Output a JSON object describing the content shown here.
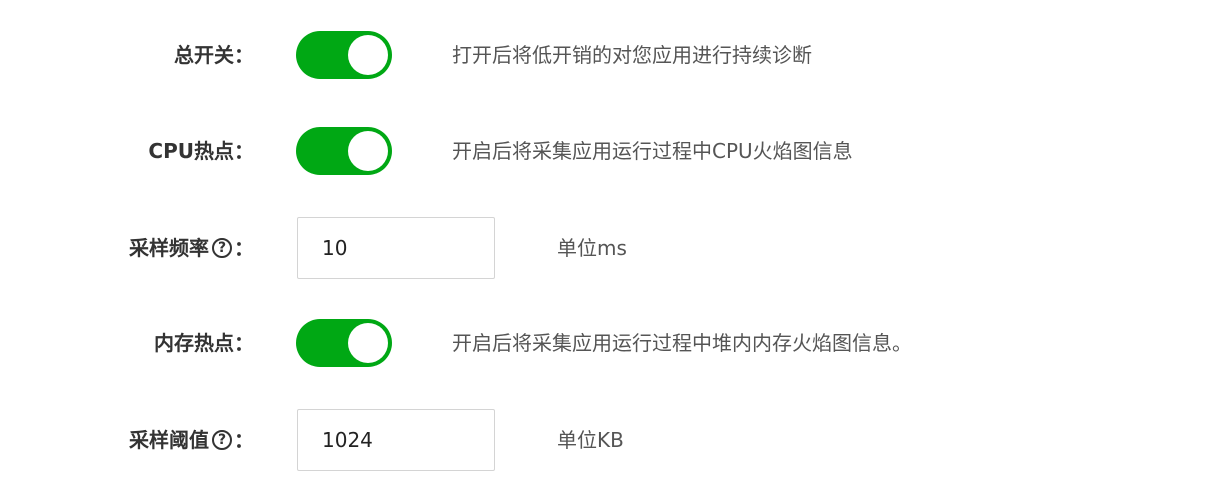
{
  "colors": {
    "toggle_on": "#00a814",
    "label_text": "#333333",
    "desc_text": "#555555"
  },
  "rows": [
    {
      "label": "总开关：",
      "toggle_on": true,
      "description": "打开后将低开销的对您应用进行持续诊断"
    },
    {
      "label": "CPU热点：",
      "toggle_on": true,
      "description": "开启后将采集应用运行过程中CPU火焰图信息"
    },
    {
      "label": "采样频率",
      "help_icon": "question-circle-icon",
      "help_glyph": "?",
      "colon": "：",
      "value": "10",
      "unit": "单位ms"
    },
    {
      "label": "内存热点：",
      "toggle_on": true,
      "description": "开启后将采集应用运行过程中堆内内存火焰图信息。"
    },
    {
      "label": "采样阈值",
      "help_icon": "question-circle-icon",
      "help_glyph": "?",
      "colon": "：",
      "value": "1024",
      "unit": "单位KB"
    }
  ]
}
